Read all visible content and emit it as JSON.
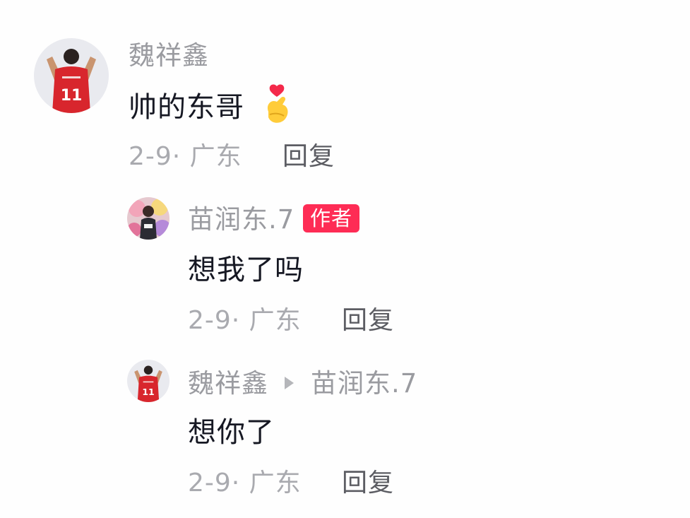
{
  "comments": [
    {
      "username": "魏祥鑫",
      "content": "帅的东哥",
      "emoji": "finger-heart-emoji",
      "meta": "2-9· 广东",
      "reply_label": "回复"
    }
  ],
  "replies": [
    {
      "username": "苗润东.7",
      "badge": "作者",
      "content": "想我了吗",
      "meta": "2-9· 广东",
      "reply_label": "回复"
    },
    {
      "username": "魏祥鑫",
      "reply_to": "苗润东.7",
      "content": "想你了",
      "meta": "2-9· 广东",
      "reply_label": "回复"
    }
  ],
  "colors": {
    "badge_bg": "#fe2c55",
    "jersey_red": "#d8262d",
    "username_gray": "#9a9ba0"
  }
}
